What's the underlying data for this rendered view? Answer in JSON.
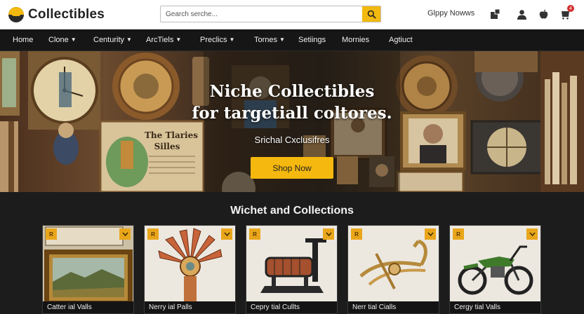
{
  "app": {
    "brand": "Collectibles",
    "brand_icon": "collectibles-logo-icon",
    "accent_color": "#f2b90f"
  },
  "header": {
    "search_placeholder": "Gearch serche...",
    "search_icon": "search-icon",
    "account_label": "Glppy Nowws",
    "icons": [
      "share-icon",
      "user-icon",
      "apple-icon",
      "cart-icon"
    ],
    "cart_badge": "4"
  },
  "nav": {
    "items": [
      {
        "label": "Home",
        "has_menu": false
      },
      {
        "label": "Clone",
        "has_menu": true
      },
      {
        "label": "Centurity",
        "has_menu": true
      },
      {
        "label": "ArcTiels",
        "has_menu": true
      },
      {
        "label": "Preclics",
        "has_menu": true
      },
      {
        "label": "Tornes",
        "has_menu": true
      },
      {
        "label": "Setiings",
        "has_menu": false
      },
      {
        "label": "Mornies",
        "has_menu": false
      },
      {
        "label": "Agtiuct",
        "has_menu": false
      }
    ]
  },
  "hero": {
    "title_line1": "Niche Collectibles",
    "title_line2": "for targetiall coltores.",
    "subtitle": "Srichal Cxclusifres",
    "cta_label": "Shop Now",
    "poster_line1": "The Tlaries",
    "poster_line2": "Silles"
  },
  "collections": {
    "title": "Wichet and Collections",
    "cards": [
      {
        "caption": "Catter ial Valls",
        "tag": "R",
        "image": "framed-landscape-painting"
      },
      {
        "caption": "Nerry ial Palls",
        "tag": "R",
        "image": "ornate-feather-totem"
      },
      {
        "caption": "Cepry tial Cullts",
        "tag": "R",
        "image": "antique-mechanical-device"
      },
      {
        "caption": "Nerr tial Cialls",
        "tag": "R",
        "image": "brass-anchor-hook"
      },
      {
        "caption": "Cergy tial Valls",
        "tag": "R",
        "image": "green-vintage-motorcycle"
      }
    ]
  }
}
